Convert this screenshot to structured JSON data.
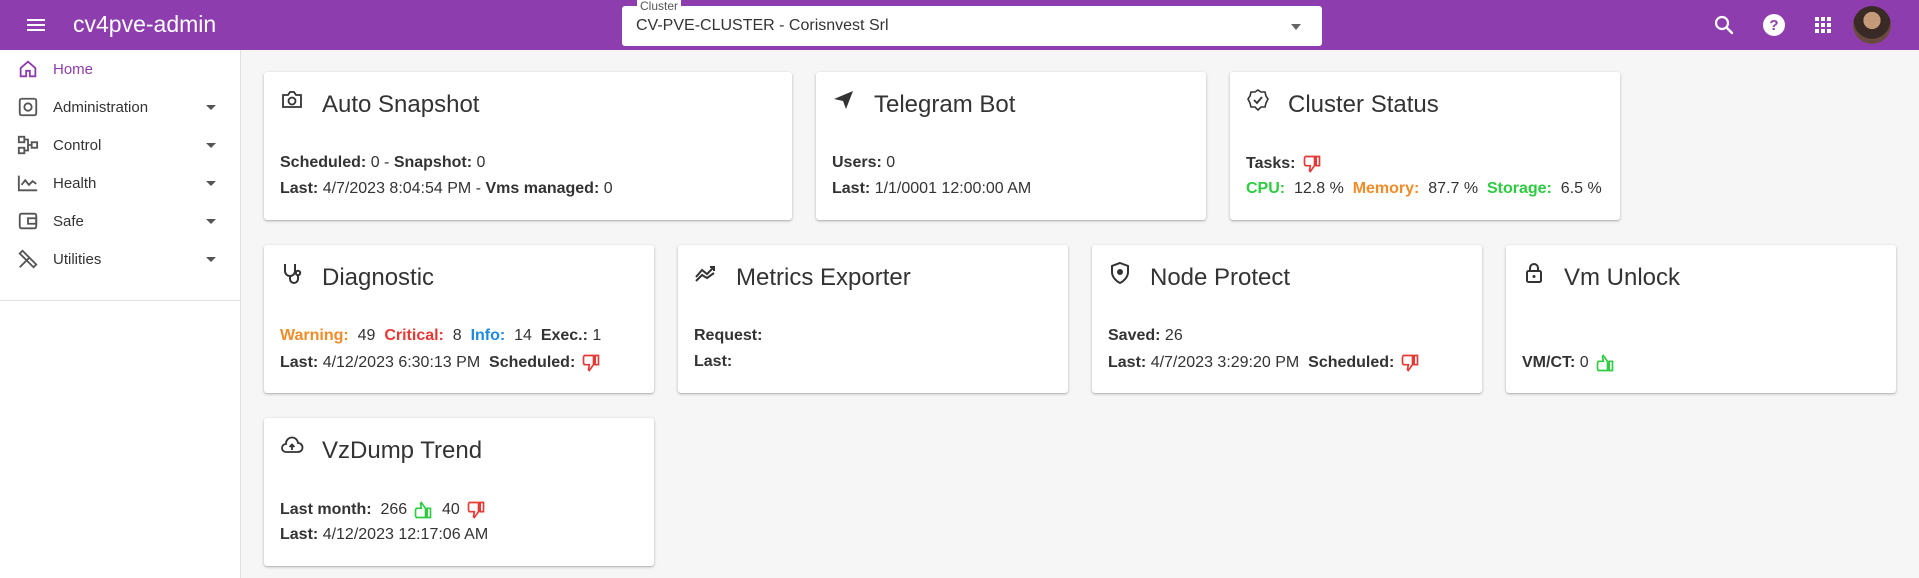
{
  "app": {
    "title": "cv4pve-admin"
  },
  "cluster": {
    "legend": "Cluster",
    "value": "CV-PVE-CLUSTER - Corisnvest Srl"
  },
  "icons": {
    "menu": "menu-icon",
    "search": "search-icon",
    "help": "help-icon",
    "apps": "apps-grid-icon"
  },
  "colors": {
    "brand": "#8e3dae",
    "warning": "#f28c28",
    "critical": "#e53935",
    "info": "#1e88e5",
    "success": "#2ecc40"
  },
  "sidebar": {
    "items": [
      {
        "label": "Home",
        "icon": "home-icon",
        "active": true
      },
      {
        "label": "Administration",
        "icon": "cog-box-icon"
      },
      {
        "label": "Control",
        "icon": "network-icon"
      },
      {
        "label": "Health",
        "icon": "pulse-icon"
      },
      {
        "label": "Safe",
        "icon": "wallet-icon"
      },
      {
        "label": "Utilities",
        "icon": "tools-icon"
      }
    ]
  },
  "cards": {
    "auto_snapshot": {
      "title": "Auto Snapshot",
      "scheduled_label": "Scheduled:",
      "scheduled": "0",
      "sep1": " - ",
      "snapshot_label": "Snapshot:",
      "snapshot": "0",
      "last_label": "Last:",
      "last": "4/7/2023 8:04:54 PM",
      "sep2": " - ",
      "vms_label": "Vms managed:",
      "vms": "0"
    },
    "telegram_bot": {
      "title": "Telegram Bot",
      "users_label": "Users:",
      "users": "0",
      "last_label": "Last:",
      "last": "1/1/0001 12:00:00 AM"
    },
    "cluster_status": {
      "title": "Cluster Status",
      "tasks_label": "Tasks:",
      "cpu_label": "CPU:",
      "cpu": "12.8 %",
      "memory_label": "Memory:",
      "memory": "87.7 %",
      "storage_label": "Storage:",
      "storage": "6.5 %"
    },
    "diagnostic": {
      "title": "Diagnostic",
      "warning_label": "Warning:",
      "warning": "49",
      "critical_label": "Critical:",
      "critical": "8",
      "info_label": "Info:",
      "info": "14",
      "exec_label": "Exec.:",
      "exec": "1",
      "last_label": "Last:",
      "last": "4/12/2023 6:30:13 PM",
      "scheduled_label": "Scheduled:"
    },
    "metrics_exporter": {
      "title": "Metrics Exporter",
      "request_label": "Request:",
      "last_label": "Last:"
    },
    "node_protect": {
      "title": "Node Protect",
      "saved_label": "Saved:",
      "saved": "26",
      "last_label": "Last:",
      "last": "4/7/2023 3:29:20 PM",
      "scheduled_label": "Scheduled:"
    },
    "vm_unlock": {
      "title": "Vm Unlock",
      "vmct_label": "VM/CT:",
      "vmct": "0"
    },
    "vzdump_trend": {
      "title": "VzDump Trend",
      "last_month_label": "Last month:",
      "ok": "266",
      "ko": "40",
      "last_label": "Last:",
      "last": "4/12/2023 12:17:06 AM"
    }
  }
}
